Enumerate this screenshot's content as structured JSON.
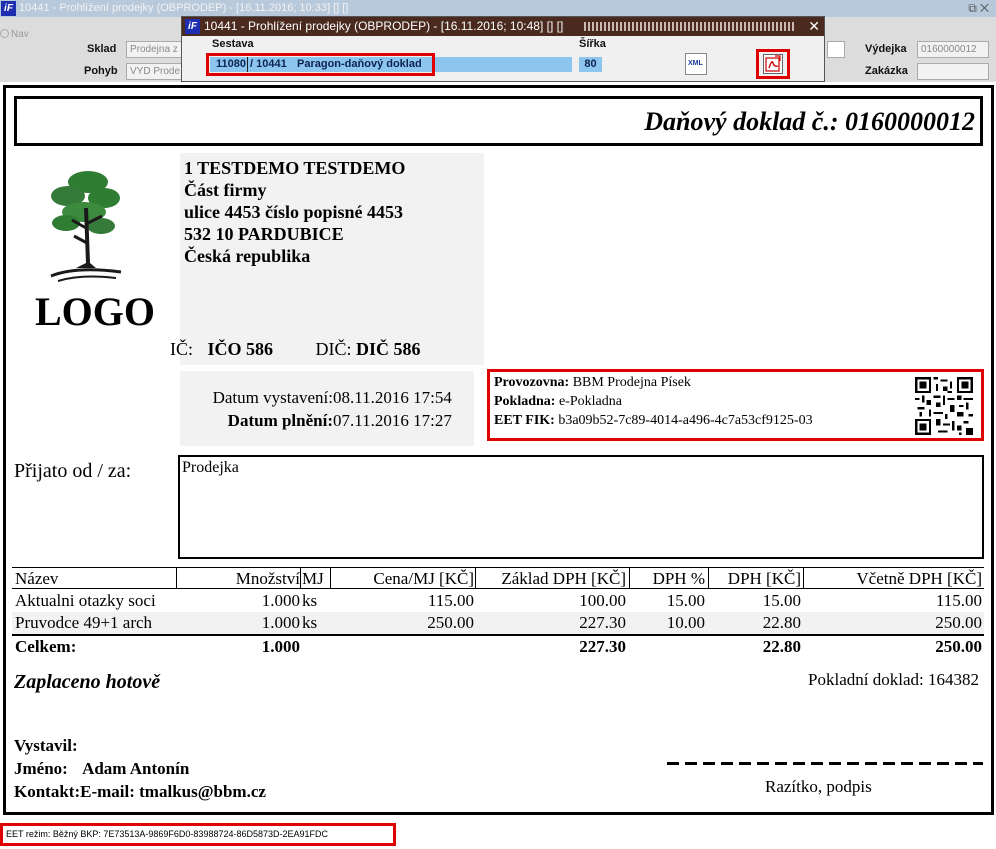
{
  "background_window": {
    "title": "10441 - Prohlížení prodejky (OBPRODEP) - [16.11.2016; 10:33] [] []",
    "radio_label": "Nav",
    "fields": [
      {
        "label": "Sklad",
        "value": "Prodejna z"
      },
      {
        "label": "Pohyb",
        "value": "VYD Prode"
      },
      {
        "label": "Výdejka",
        "value": "0160000012"
      },
      {
        "label": "Zakázka",
        "value": ""
      }
    ]
  },
  "dialog": {
    "title": "10441 - Prohlížení prodejky (OBPRODEP) - [16.11.2016; 10:48]  []  []",
    "close_label": "✕",
    "sestava_label": "Sestava",
    "sirka_label": "Šířka",
    "sestava_code": "11080",
    "sestava_code2": "/ 10441",
    "sestava_name": "Paragon-daňový doklad",
    "sirka_value": "80",
    "xml_label": "XML"
  },
  "invoice": {
    "title": "Daňový doklad č.: 0160000012",
    "logo_text": "LOGO",
    "company": [
      "1 TESTDEMO TESTDEMO",
      "Část firmy",
      "ulice 4453 číslo popisné 4453",
      "532 10 PARDUBICE",
      "Česká republika"
    ],
    "ic_label": "IČ:",
    "ic_value": "IČO 586",
    "dic_label": "DIČ:",
    "dic_value": "DIČ 586",
    "datum_vystaveni_label": "Datum vystavení:",
    "datum_vystaveni": "08.11.2016 17:54",
    "datum_plneni_label": "Datum plnění:",
    "datum_plneni": "07.11.2016 17:27",
    "eet": {
      "provozovna_label": "Provozovna:",
      "provozovna": "BBM Prodejna Písek",
      "pokladna_label": "Pokladna:",
      "pokladna": "e-Pokladna",
      "fik_label": "EET FIK:",
      "fik": "b3a09b52-7c89-4014-a496-4c7a53cf9125-03"
    },
    "prijato_label": "Přijato od / za:",
    "prijato_value": "Prodejka",
    "table": {
      "headers": [
        "Název",
        "Množství",
        "MJ",
        "Cena/MJ [KČ]",
        "Základ DPH [KČ]",
        "DPH %",
        "DPH [KČ]",
        "Včetně DPH [KČ]"
      ],
      "rows": [
        [
          "Aktualni otazky soci",
          "1.000",
          "ks",
          "115.00",
          "100.00",
          "15.00",
          "15.00",
          "115.00"
        ],
        [
          "Pruvodce 49+1 arch",
          "1.000",
          "ks",
          "250.00",
          "227.30",
          "10.00",
          "22.80",
          "250.00"
        ]
      ],
      "total": [
        "Celkem:",
        "1.000",
        "",
        "",
        "227.30",
        "",
        "22.80",
        "250.00"
      ]
    },
    "paid_text": "Zaplaceno hotově",
    "pokladni_doklad": "Pokladní doklad: 164382",
    "vystavil_label": "Vystavil:",
    "jmeno_label": "Jméno:",
    "jmeno_value": "Adam Antonín",
    "kontakt_label": "Kontakt:",
    "kontakt_value": "E-mail: tmalkus@bbm.cz",
    "stamp_label": "Razítko, podpis"
  },
  "footer": "EET režim: Běžný BKP: 7E73513A-9869F6D0-83988724-86D5873D-2EA91FDC",
  "colors": {
    "highlight_red": "#e00000",
    "selection_blue": "#8cc6ee",
    "dialog_titlebar": "#4a2a1e"
  }
}
